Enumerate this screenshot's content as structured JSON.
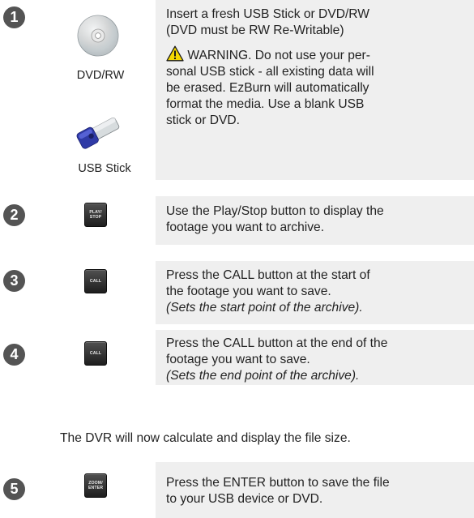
{
  "steps": [
    {
      "number": "1",
      "dvd_caption": "DVD/RW",
      "usb_caption": "USB Stick",
      "line1": "Insert a fresh USB Stick or DVD/RW",
      "line2": "(DVD must be RW Re-Writable)",
      "warn1": " WARNING. Do not use your per-",
      "warn2": "sonal USB stick - all existing data will",
      "warn3": "be erased.  EzBurn will automatically",
      "warn4": "format the media.  Use a blank USB",
      "warn5": "stick or DVD."
    },
    {
      "number": "2",
      "button_label": "PLAY/\nSTOP",
      "line1": "Use the Play/Stop button to display the",
      "line2": "footage you want to archive."
    },
    {
      "number": "3",
      "button_label": "CALL",
      "line1": "Press the CALL button at the start of",
      "line2": "the footage you want to save.",
      "note": "(Sets the start point of the archive)."
    },
    {
      "number": "4",
      "button_label": "CALL",
      "line1": "Press the CALL button at the end of the",
      "line2": "footage you want to save.",
      "note": "(Sets the end point of the archive)."
    },
    {
      "number": "5",
      "button_label": "ZOOM/\nENTER",
      "line1": "Press the ENTER button to save the file",
      "line2": "to your USB device or DVD."
    }
  ],
  "intermediate_text": "The DVR will now calculate and display the file size.",
  "icons": {
    "disc": "dvd-disc-icon",
    "usb": "usb-stick-icon",
    "warning": "warning-triangle-icon"
  },
  "colors": {
    "number_badge": "#545454",
    "box_bg": "#efefef",
    "warning_fill": "#f5d800"
  }
}
